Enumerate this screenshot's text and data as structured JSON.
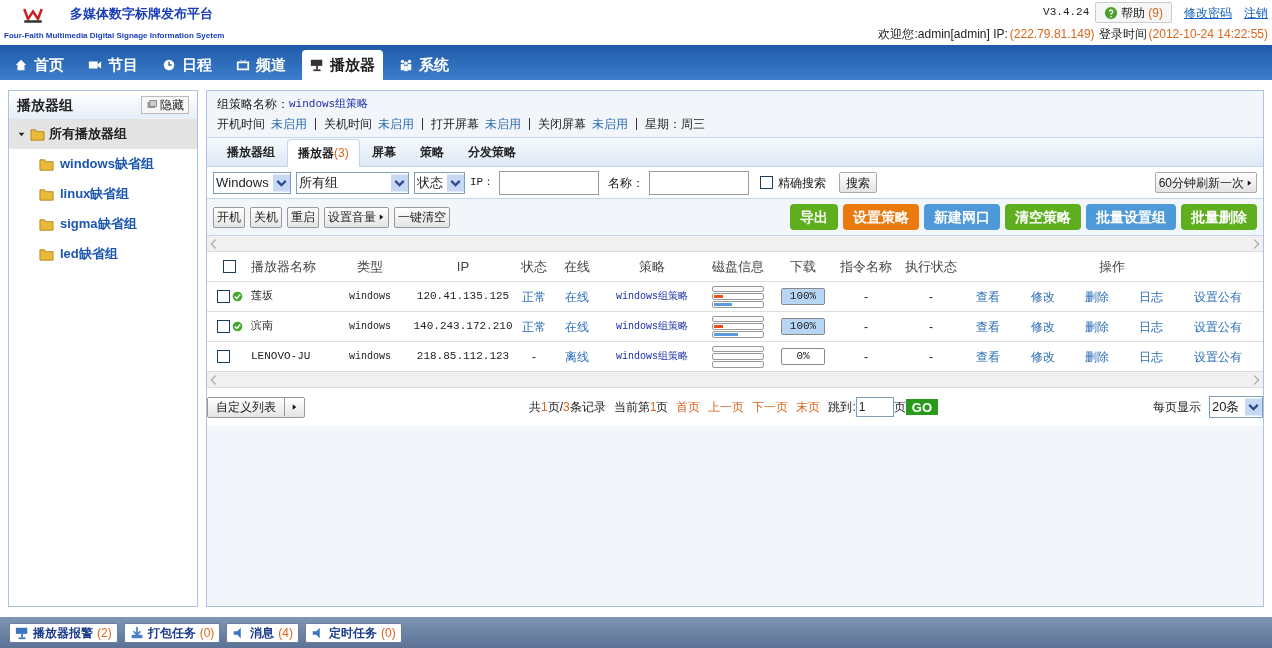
{
  "header": {
    "title": "多媒体数字标牌发布平台",
    "subtitle": "Four-Faith Multimedia Digital Signage Information Syetem",
    "version": "V3.4.24",
    "help": {
      "label": "帮助",
      "count": "(9)"
    },
    "links": [
      "修改密码",
      "注销"
    ],
    "welcome": "欢迎您:admin[admin] IP:",
    "ip": "(222.79.81.149)",
    "login_label": "登录时间",
    "login_time": "(2012-10-24 14:22:55)"
  },
  "nav": [
    {
      "label": "首页",
      "selected": false
    },
    {
      "label": "节目",
      "selected": false
    },
    {
      "label": "日程",
      "selected": false
    },
    {
      "label": "频道",
      "selected": false
    },
    {
      "label": "播放器",
      "selected": true
    },
    {
      "label": "系统",
      "selected": false
    }
  ],
  "sidebar": {
    "title": "播放器组",
    "hide_button": "隐藏",
    "tree": [
      {
        "label": "所有播放器组",
        "selected": true,
        "expanded": true,
        "children": [
          {
            "label": "windows缺省组",
            "selected": false
          },
          {
            "label": "linux缺省组",
            "selected": false
          },
          {
            "label": "sigma缺省组",
            "selected": false
          },
          {
            "label": "led缺省组",
            "selected": false
          }
        ]
      }
    ]
  },
  "policy": {
    "name_label": "组策略名称：",
    "name": "windows组策略",
    "items": [
      {
        "label": "开机时间",
        "value": "未启用"
      },
      {
        "label": "关机时间",
        "value": "未启用"
      },
      {
        "label": "打开屏幕",
        "value": "未启用"
      },
      {
        "label": "关闭屏幕",
        "value": "未启用"
      }
    ],
    "weekday": "星期：周三"
  },
  "subtabs": [
    {
      "label": "播放器组",
      "selected": false
    },
    {
      "label": "播放器",
      "count": "(3)",
      "selected": true
    },
    {
      "label": "屏幕",
      "selected": false
    },
    {
      "label": "策略",
      "selected": false
    },
    {
      "label": "分发策略",
      "selected": false
    }
  ],
  "filters": {
    "os": "Windows",
    "group": "所有组",
    "status": "状态",
    "ip_label": "IP：",
    "name_label": "名称：",
    "exact_label": "精确搜索",
    "exact_checked": false,
    "search": "搜索",
    "refresh": "60分钟刷新一次"
  },
  "actions": [
    "开机",
    "关机",
    "重启",
    "设置音量",
    "一键清空"
  ],
  "big_buttons": [
    {
      "label": "导出",
      "color": "#5fae1e"
    },
    {
      "label": "设置策略",
      "color": "#ea7a0c"
    },
    {
      "label": "新建网口",
      "color": "#4e9ad8"
    },
    {
      "label": "清空策略",
      "color": "#5fae1e"
    },
    {
      "label": "批量设置组",
      "color": "#4e9ad8"
    },
    {
      "label": "批量删除",
      "color": "#5fae1e"
    }
  ],
  "table": {
    "select_all_checked": false,
    "columns": [
      "播放器名称",
      "类型",
      "IP",
      "状态",
      "在线",
      "策略",
      "磁盘信息",
      "下载",
      "指令名称",
      "执行状态",
      "操作"
    ],
    "rows": [
      {
        "checked": false,
        "online": true,
        "name": "莲坂",
        "type": "windows",
        "ip": "120.41.135.125",
        "status": "正常",
        "online_text": "在线",
        "policy": "windows组策略",
        "disk": [
          {
            "level": 0.18
          },
          {
            "level": 0.38
          }
        ],
        "download": {
          "level": 1,
          "reading": "100%"
        },
        "command": "-",
        "exec": "-",
        "ops": [
          "查看",
          "修改",
          "删除",
          "日志",
          "设置公有"
        ]
      },
      {
        "checked": false,
        "online": true,
        "name": "滨南",
        "type": "windows",
        "ip": "140.243.172.210",
        "status": "正常",
        "online_text": "在线",
        "policy": "windows组策略",
        "disk": [
          {
            "level": 0.18
          },
          {
            "level": 0.5
          }
        ],
        "download": {
          "level": 1,
          "reading": "100%"
        },
        "command": "-",
        "exec": "-",
        "ops": [
          "查看",
          "修改",
          "删除",
          "日志",
          "设置公有"
        ]
      },
      {
        "checked": false,
        "online": false,
        "name": "LENOVO-JU",
        "type": "windows",
        "ip": "218.85.112.123",
        "status": "-",
        "online_text": "离线",
        "policy": "windows组策略",
        "disk": [
          {
            "level": 0
          },
          {
            "level": 0
          }
        ],
        "download": {
          "level": 0,
          "reading": "0%"
        },
        "command": "-",
        "exec": "-",
        "ops": [
          "查看",
          "修改",
          "删除",
          "日志",
          "设置公有"
        ]
      }
    ]
  },
  "pager": {
    "custom_list": "自定义列表",
    "summary": {
      "prefix": "共",
      "pages": "1",
      "middle": "页/",
      "records": "3",
      "suffix": "条记录"
    },
    "current": {
      "prefix": "当前第",
      "page": "1",
      "suffix": "页"
    },
    "links": [
      "首页",
      "上一页",
      "下一页",
      "末页"
    ],
    "jump_label": "跳到:",
    "jump_value": "1",
    "page_suffix": "页",
    "go": "GO",
    "per_page_label": "每页显示",
    "per_page": "20条"
  },
  "status_bar": [
    {
      "label": "播放器报警",
      "count": "(2)"
    },
    {
      "label": "打包任务",
      "count": "(0)"
    },
    {
      "label": "消息",
      "count": "(4)"
    },
    {
      "label": "定时任务",
      "count": "(0)"
    }
  ]
}
